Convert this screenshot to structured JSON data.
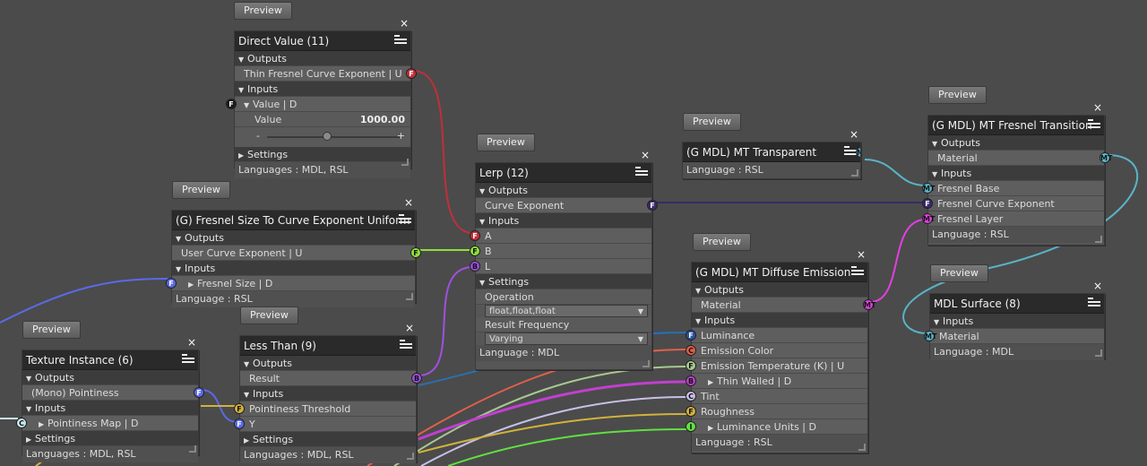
{
  "preview_label": "Preview",
  "nodes": {
    "direct_value": {
      "title": "Direct Value (11)",
      "outputs_label": "Outputs",
      "output": "Thin Fresnel Curve Exponent  | U",
      "inputs_label": "Inputs",
      "value_label": "Value  | D",
      "value_name": "Value",
      "value": "1000.00",
      "minus": "-",
      "plus": "+",
      "settings_label": "Settings",
      "footer": "Languages : MDL, RSL"
    },
    "fresnel_size": {
      "title": "(G) Fresnel Size To Curve Exponent Uniform",
      "outputs_label": "Outputs",
      "output": "User Curve Exponent  | U",
      "inputs_label": "Inputs",
      "input": "Fresnel Size  | D",
      "footer": "Language : RSL"
    },
    "lerp": {
      "title": "Lerp (12)",
      "outputs_label": "Outputs",
      "output": "Curve Exponent",
      "inputs_label": "Inputs",
      "in_a": "A",
      "in_b": "B",
      "in_l": "L",
      "settings_label": "Settings",
      "operation_label": "Operation",
      "operation_value": "float,float,float",
      "result_freq_label": "Result Frequency",
      "result_freq_value": "Varying",
      "footer": "Language : MDL"
    },
    "transparent": {
      "title": "(G MDL) MT Transparent",
      "footer": "Language : RSL"
    },
    "fresnel_transition": {
      "title": "(G MDL) MT Fresnel Transition",
      "outputs_label": "Outputs",
      "output": "Material",
      "inputs_label": "Inputs",
      "in1": "Fresnel Base",
      "in2": "Fresnel Curve Exponent",
      "in3": "Fresnel Layer",
      "footer": "Language : RSL"
    },
    "diffuse_emission": {
      "title": "(G MDL) MT Diffuse Emission",
      "outputs_label": "Outputs",
      "output": "Material",
      "inputs_label": "Inputs",
      "in1": "Luminance",
      "in2": "Emission Color",
      "in3": "Emission Temperature (K)  | U",
      "in4": "Thin Walled  | D",
      "in5": "Tint",
      "in6": "Roughness",
      "in7": "Luminance Units  | D",
      "footer": "Language : RSL"
    },
    "mdl_surface": {
      "title": "MDL Surface (8)",
      "inputs_label": "Inputs",
      "input": "Material",
      "footer": "Language : MDL"
    },
    "less_than": {
      "title": "Less Than (9)",
      "outputs_label": "Outputs",
      "output": "Result",
      "inputs_label": "Inputs",
      "in1": "Pointiness Threshold",
      "in2": "Y",
      "settings_label": "Settings",
      "footer": "Languages : MDL, RSL"
    },
    "texture_instance": {
      "title": "Texture Instance (6)",
      "outputs_label": "Outputs",
      "output": "(Mono) Pointiness",
      "inputs_label": "Inputs",
      "input": "Pointiness Map  | D",
      "settings_label": "Settings",
      "footer": "Languages : MDL, RSL"
    }
  },
  "ports": {
    "F": "F",
    "B": "B",
    "C": "C",
    "MT": "MT",
    "I": "I"
  },
  "colors": {
    "float_red": "#c0303a",
    "float_green": "#8ee03a",
    "float_blue": "#5a6ae8",
    "float_yellow": "#d2b23a",
    "bool_purple": "#a050e0",
    "color_red": "#e0604a",
    "color_pale": "#c8c0e8",
    "material_cyan": "#5ab4c8",
    "material_magenta": "#e040e0",
    "curve_navy": "#3a2a6a",
    "int_green": "#60e040"
  }
}
